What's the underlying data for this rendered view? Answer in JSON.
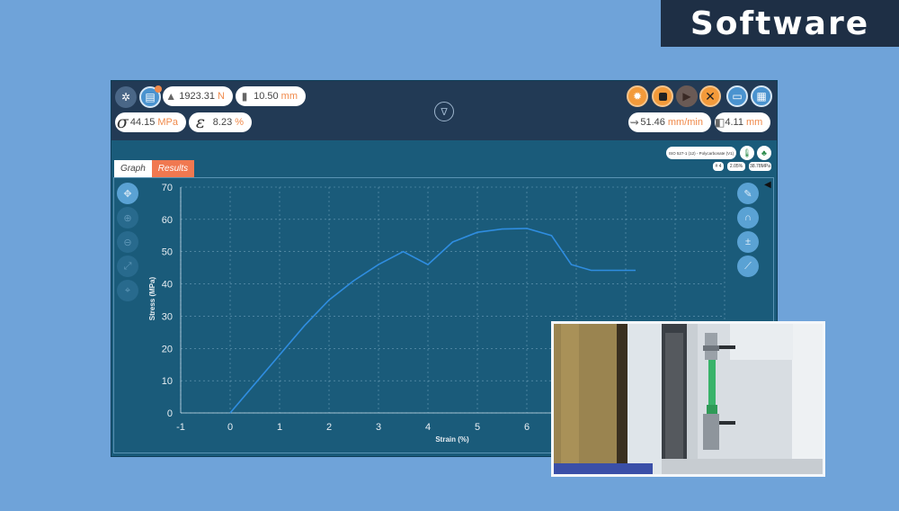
{
  "banner": {
    "title": "Software"
  },
  "toolbar": {
    "force": {
      "value": "1923.31",
      "unit": "N"
    },
    "position": {
      "value": "10.50",
      "unit": "mm"
    },
    "stress": {
      "symbol": "σ",
      "value": "44.15",
      "unit": "MPa"
    },
    "strain": {
      "symbol": "ε",
      "value": "8.23",
      "unit": "%"
    },
    "speed": {
      "value": "51.46",
      "unit": "mm/min"
    },
    "extension": {
      "value": "4.11",
      "unit": "mm"
    }
  },
  "tabs": [
    {
      "label": "Graph",
      "active": true
    },
    {
      "label": "Results",
      "active": false
    }
  ],
  "standard": {
    "label": "ISO 527-1 (12) - Polycarbonate (V1)",
    "chips": [
      "# 4",
      "2.05%",
      "38.78MPa"
    ]
  },
  "colors": {
    "accent_orange": "#f39a3a",
    "tab_results": "#f07850",
    "curve": "#2f8de0",
    "plot_bg": "#1a5b7a",
    "banner_bg": "#1e2f45"
  },
  "chart_data": {
    "type": "line",
    "title": "",
    "xlabel": "Strain (%)",
    "ylabel": "Stress (MPa)",
    "xlim": [
      -1,
      10
    ],
    "ylim": [
      0,
      70
    ],
    "xticks": [
      -1,
      0,
      1,
      2,
      3,
      4,
      5,
      6
    ],
    "yticks": [
      0,
      10,
      20,
      30,
      40,
      50,
      60,
      70
    ],
    "grid": true,
    "series": [
      {
        "x": [
          0,
          0.5,
          1,
          1.5,
          2,
          2.5,
          3,
          3.5,
          4,
          4.5,
          5,
          5.5,
          6,
          6.5,
          6.9,
          7.3,
          8.2
        ],
        "y": [
          0,
          9,
          18,
          27,
          35,
          41,
          46,
          50,
          46,
          53,
          56,
          57,
          57.2,
          55,
          46,
          44.2,
          44.2
        ]
      }
    ]
  }
}
